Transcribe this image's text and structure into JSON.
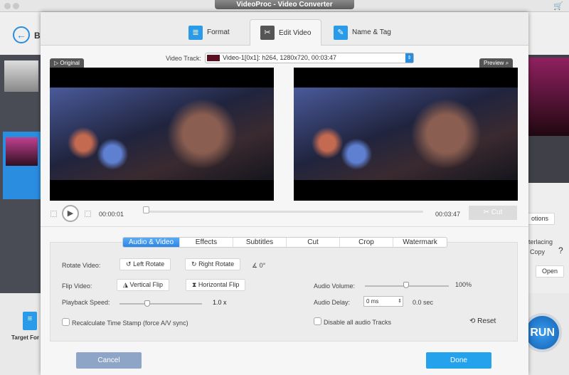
{
  "window": {
    "title": "VideoProc - Video Converter"
  },
  "background": {
    "back_label": "B",
    "target_format": "Target For",
    "options_label": "otions",
    "deinterlacing": "terlacing",
    "copy": "Copy",
    "help": "?",
    "open": "Open",
    "run": "RUN"
  },
  "dialog_tabs": [
    {
      "label": "Format",
      "icon": "format-icon"
    },
    {
      "label": "Edit Video",
      "icon": "edit-video-icon",
      "active": true
    },
    {
      "label": "Name & Tag",
      "icon": "name-tag-icon"
    }
  ],
  "video_track": {
    "label": "Video Track:",
    "value": "Video-1[0x1]: h264, 1280x720, 00:03:47"
  },
  "panes": {
    "original": "Original",
    "preview": "Preview"
  },
  "player": {
    "current_time": "00:00:01",
    "duration": "00:03:47",
    "cut_label": "Cut",
    "progress": 0.004
  },
  "sub_tabs": [
    "Audio & Video",
    "Effects",
    "Subtitles",
    "Cut",
    "Crop",
    "Watermark"
  ],
  "settings": {
    "rotate_label": "Rotate Video:",
    "left_rotate": "Left Rotate",
    "right_rotate": "Right Rotate",
    "angle": "0°",
    "flip_label": "Flip Video:",
    "vertical_flip": "Vertical Flip",
    "horizontal_flip": "Horizontal Flip",
    "speed_label": "Playback Speed:",
    "speed_value": "1.0",
    "speed_unit": "x",
    "recalc_label": "Recalculate Time Stamp (force A/V sync)",
    "recalc_checked": false,
    "volume_label": "Audio Volume:",
    "volume_value": "100%",
    "delay_label": "Audio Delay:",
    "delay_value": "0 ms",
    "delay_sec": "0.0 sec",
    "disable_audio_label": "Disable all audio Tracks",
    "disable_audio_checked": false,
    "reset": "Reset"
  },
  "buttons": {
    "cancel": "Cancel",
    "done": "Done"
  },
  "colors": {
    "accent": "#24a3ec",
    "cancel": "#8fa5c7"
  }
}
